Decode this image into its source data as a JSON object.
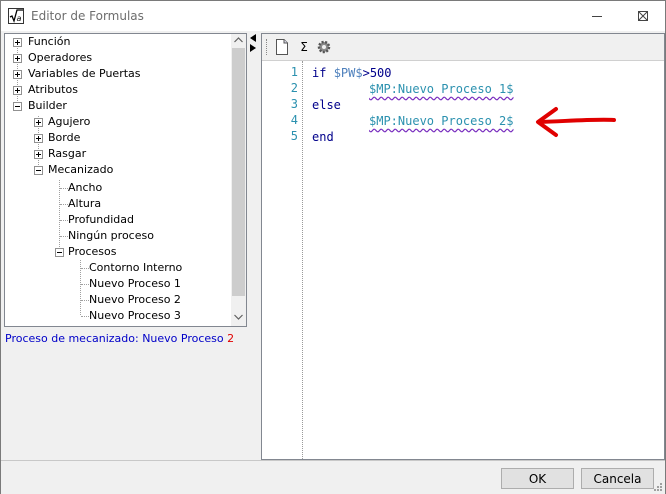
{
  "window": {
    "title": "Editor de Formulas"
  },
  "tree": {
    "items": [
      {
        "label": "Función"
      },
      {
        "label": "Operadores"
      },
      {
        "label": "Variables de Puertas"
      },
      {
        "label": "Atributos"
      },
      {
        "label": "Builder"
      },
      {
        "label": "Agujero"
      },
      {
        "label": "Borde"
      },
      {
        "label": "Rasgar"
      },
      {
        "label": "Mecanizado"
      },
      {
        "label": "Ancho"
      },
      {
        "label": "Altura"
      },
      {
        "label": "Profundidad"
      },
      {
        "label": "Ningún proceso"
      },
      {
        "label": "Procesos"
      },
      {
        "label": "Contorno Interno"
      },
      {
        "label": "Nuevo Proceso 1"
      },
      {
        "label": "Nuevo Proceso 2"
      },
      {
        "label": "Nuevo Proceso 3"
      }
    ]
  },
  "status": {
    "text": "Proceso de mecanizado: Nuevo Proceso ",
    "number": "2"
  },
  "toolbar": {
    "sigma": "Σ"
  },
  "editor": {
    "line_numbers": [
      "1",
      "2",
      "3",
      "4",
      "5"
    ],
    "line1": {
      "kw": "if",
      "var": "$PW$",
      "rest": ">500"
    },
    "line2": {
      "ref": "$MP:Nuevo Proceso 1$"
    },
    "line3": {
      "kw": "else"
    },
    "line4": {
      "ref": "$MP:Nuevo Proceso 2$"
    },
    "line5": {
      "kw": "end"
    }
  },
  "buttons": {
    "ok": "OK",
    "cancel": "Cancela"
  },
  "icons": [
    "formula-app-icon",
    "minimize-icon",
    "maximize-icon",
    "close-icon",
    "new-document-icon",
    "sigma-icon",
    "gear-icon",
    "annotation-arrow"
  ],
  "colors": {
    "keyword": "#00008b",
    "variable": "#4f81bd",
    "reference": "#2b91af",
    "annotation": "#e00000",
    "status": "#0000c8"
  }
}
